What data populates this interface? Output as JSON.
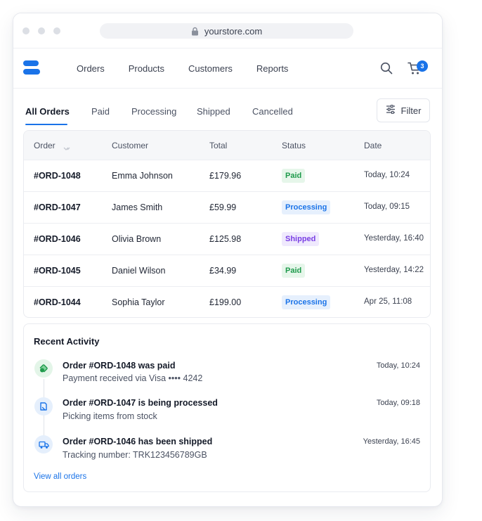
{
  "browser": {
    "url": "yourstore.com",
    "icons": [
      "lock-icon"
    ]
  },
  "nav": {
    "links": [
      "Orders",
      "Products",
      "Customers",
      "Reports"
    ],
    "cart_count": "3",
    "icons": [
      "logo",
      "search-icon",
      "cart-icon"
    ]
  },
  "tabs": {
    "items": [
      "All Orders",
      "Paid",
      "Processing",
      "Shipped",
      "Cancelled"
    ],
    "active": "All Orders",
    "filter_label": "Filter"
  },
  "table": {
    "headers": [
      "Order",
      "Customer",
      "Total",
      "Status",
      "Date"
    ],
    "rows": [
      {
        "order": "#ORD-1048",
        "customer": "Emma Johnson",
        "total": "£179.96",
        "status": "Paid",
        "date": "Today, 10:24"
      },
      {
        "order": "#ORD-1047",
        "customer": "James Smith",
        "total": "£59.99",
        "status": "Processing",
        "date": "Today, 09:15"
      },
      {
        "order": "#ORD-1046",
        "customer": "Olivia Brown",
        "total": "£125.98",
        "status": "Shipped",
        "date": "Yesterday, 16:40"
      },
      {
        "order": "#ORD-1045",
        "customer": "Daniel Wilson",
        "total": "£34.99",
        "status": "Paid",
        "date": "Yesterday, 14:22"
      },
      {
        "order": "#ORD-1044",
        "customer": "Sophia Taylor",
        "total": "£199.00",
        "status": "Processing",
        "date": "Apr 25, 11:08"
      }
    ]
  },
  "activity": {
    "title": "Recent Activity",
    "items": [
      {
        "title": "Order #ORD-1048 was paid",
        "detail": "Payment received via Visa •••• 4242",
        "time": "Today, 10:24",
        "icon": "payment-icon"
      },
      {
        "title": "Order #ORD-1047 is being processed",
        "detail": "Picking items from stock",
        "time": "Today, 09:18",
        "icon": "processing-icon"
      },
      {
        "title": "Order #ORD-1046 has been shipped",
        "detail": "Tracking number: TRK123456789GB",
        "time": "Yesterday, 16:45",
        "icon": "truck-icon"
      }
    ],
    "view_all": "View all orders"
  },
  "colors": {
    "accent": "#1a73e8",
    "paid": "#1e9a4b",
    "processing": "#1a73e8",
    "shipped": "#7a3fe4"
  }
}
